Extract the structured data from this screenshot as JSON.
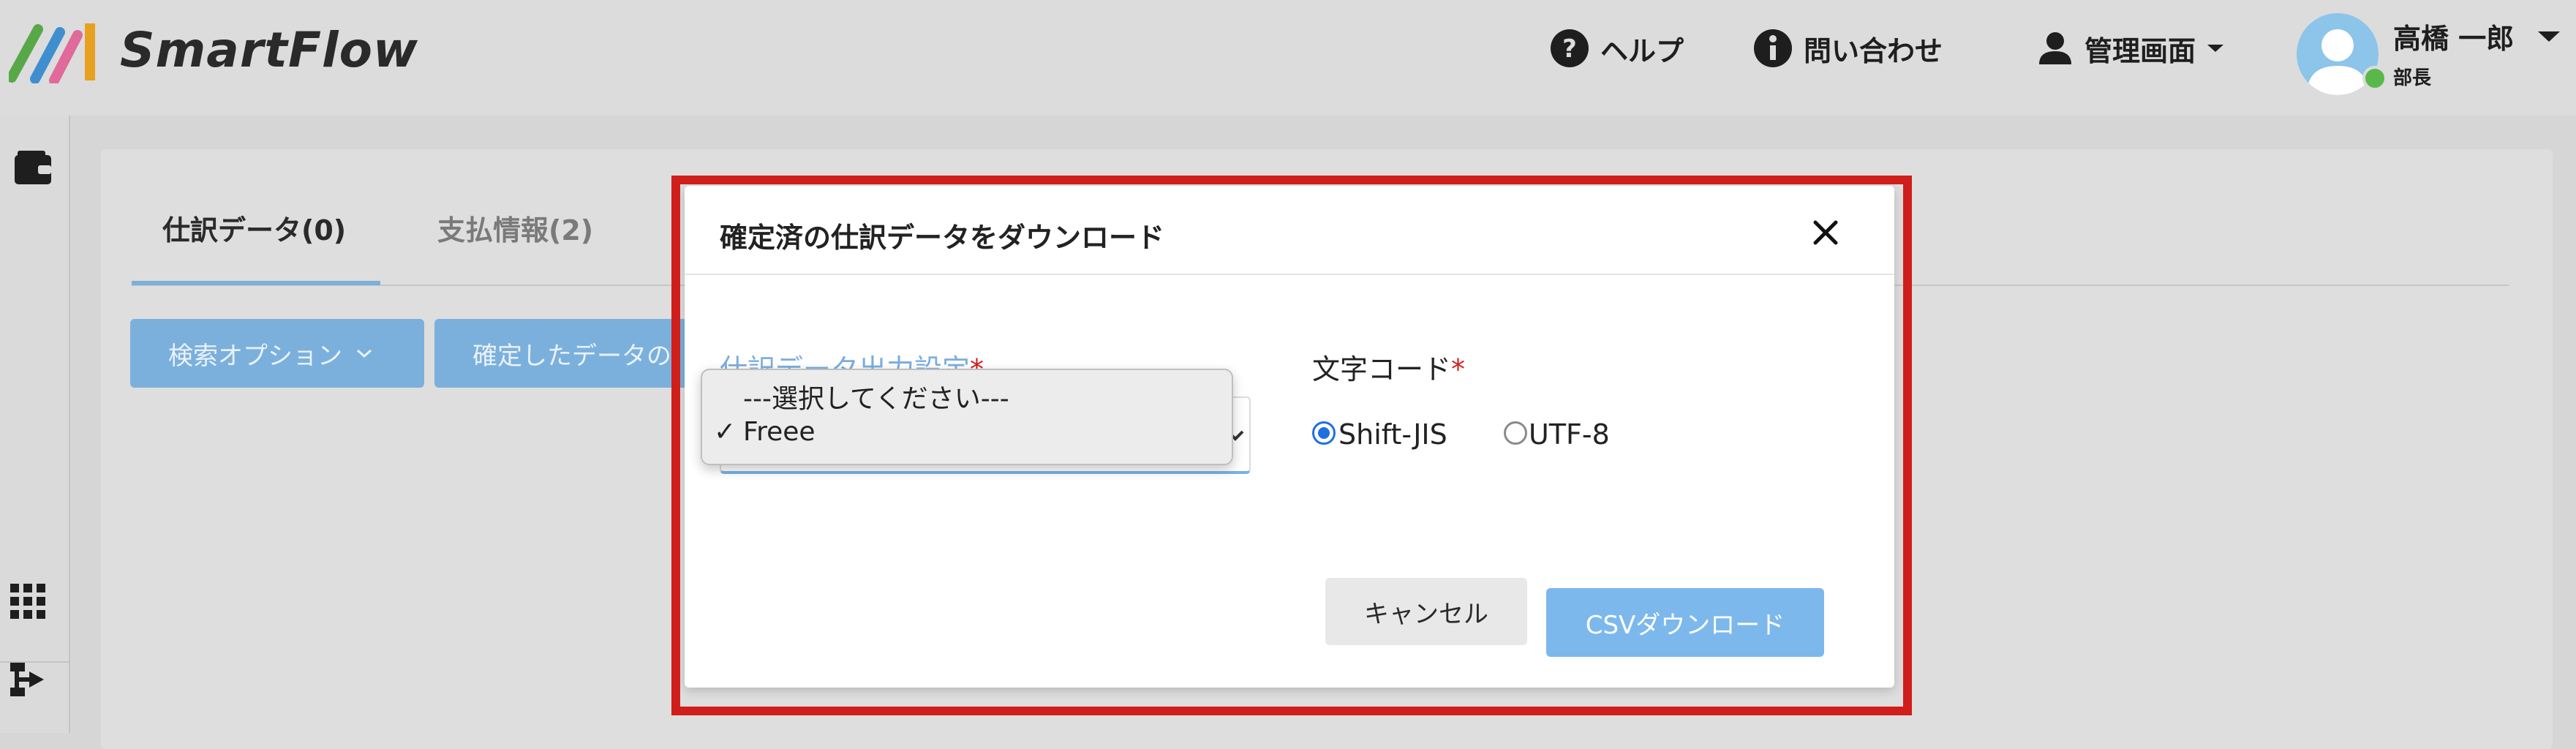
{
  "header": {
    "brand": "SmartFlow",
    "help_label": "ヘルプ",
    "contact_label": "問い合わせ",
    "admin_label": "管理画面",
    "user_name": "高橋 一郎",
    "user_role": "部長"
  },
  "main": {
    "tabs": [
      {
        "label": "仕訳データ(0)"
      },
      {
        "label": "支払情報(2)"
      }
    ],
    "search_options_label": "検索オプション",
    "confirmed_data_label": "確定したデータの"
  },
  "modal": {
    "title": "確定済の仕訳データをダウンロード",
    "output_setting_label": "仕訳データ出力設定",
    "required_mark": "*",
    "select": {
      "options": [
        {
          "label": "---選択してください---"
        },
        {
          "label": "Freee"
        }
      ],
      "checkmark": "✓"
    },
    "charset": {
      "label": "文字コード",
      "options": [
        {
          "label": "Shift-JIS",
          "checked": true
        },
        {
          "label": "UTF-8",
          "checked": false
        }
      ]
    },
    "cancel_label": "キャンセル",
    "csv_download_label": "CSVダウンロード"
  },
  "colors": {
    "accent_blue": "#7cb0dc",
    "highlight_red": "#d01f1b",
    "required_red": "#d01f1b"
  }
}
